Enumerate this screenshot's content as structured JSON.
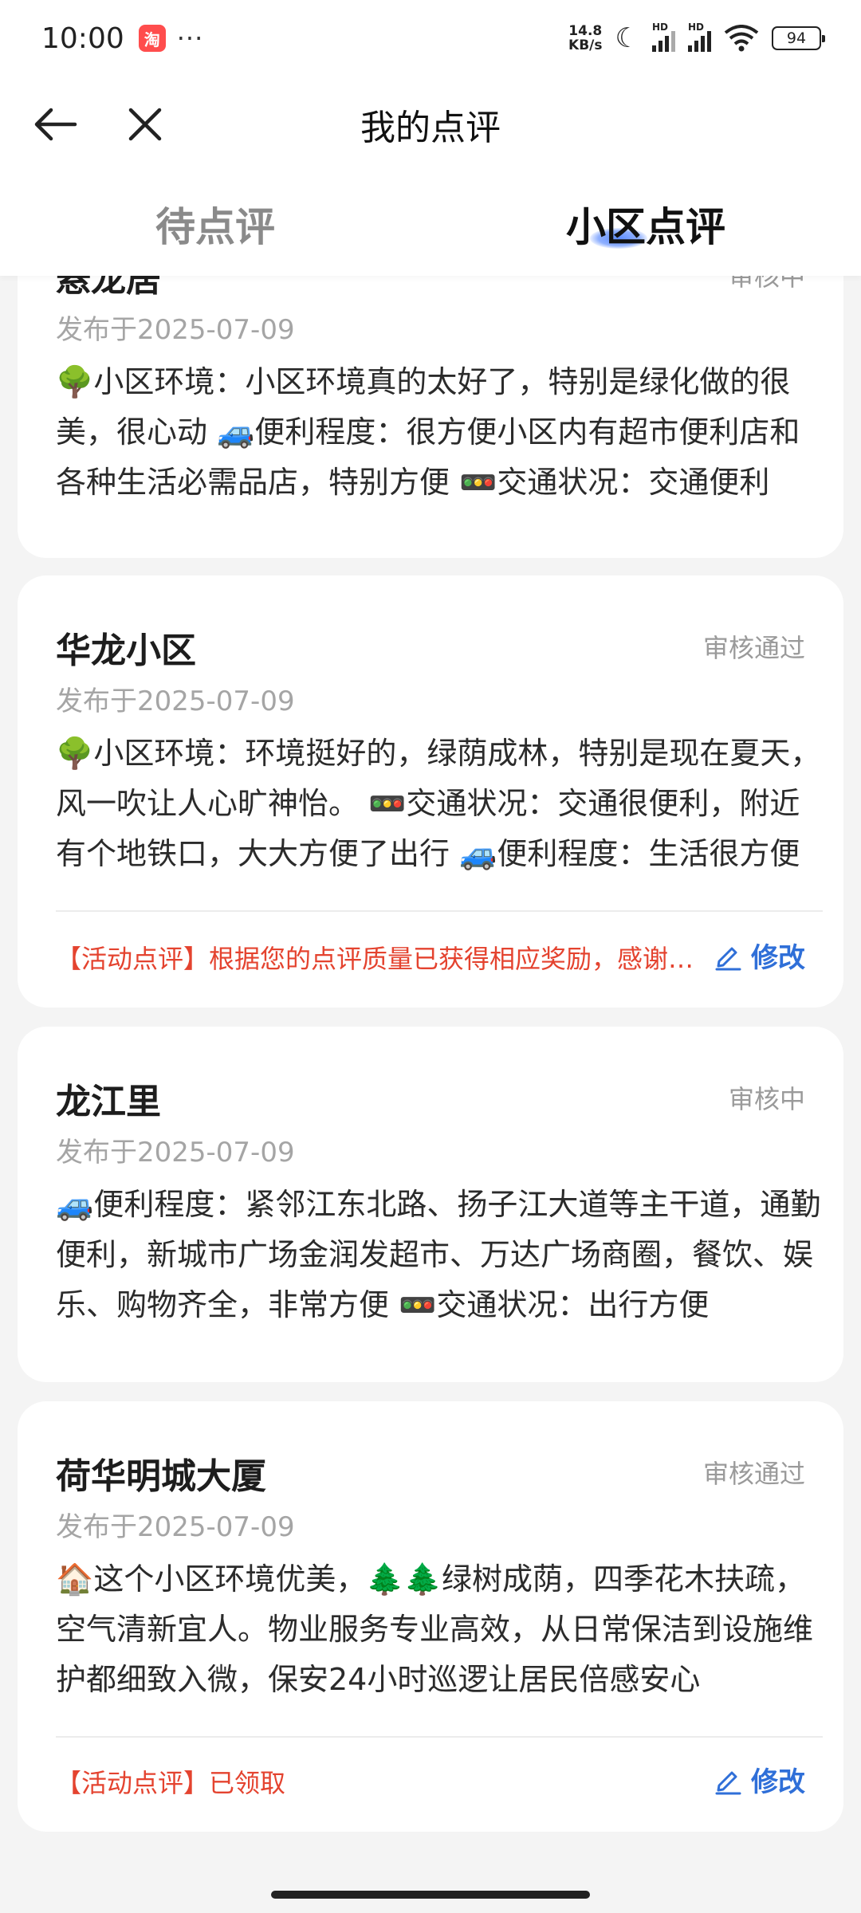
{
  "status_bar": {
    "time": "10:00",
    "app_icon": "taobao-icon",
    "dots": "···",
    "speed_value": "14.8",
    "speed_unit": "KB/s",
    "hd_label": "HD",
    "battery": "94"
  },
  "nav": {
    "title": "我的点评"
  },
  "tabs": [
    {
      "label": "待点评",
      "active": false
    },
    {
      "label": "小区点评",
      "active": true
    }
  ],
  "reviews": [
    {
      "name": "悬龙居",
      "status": "审核中",
      "date": "发布于2025-07-09",
      "text": "🌳小区环境：小区环境真的太好了，特别是绿化做的很美，很心动 🚙便利程度：很方便小区内有超市便利店和各种生活必需品店，特别方便 🚥交通状况：交通便利",
      "reward": null,
      "edit": null
    },
    {
      "name": "华龙小区",
      "status": "审核通过",
      "date": "发布于2025-07-09",
      "text": "🌳小区环境：环境挺好的，绿荫成林，特别是现在夏天，风一吹让人心旷神怡。 🚥交通状况：交通很便利，附近有个地铁口，大大方便了出行 🚙便利程度：生活很方便",
      "reward": "【活动点评】根据您的点评质量已获得相应奖励，感谢参与",
      "edit": "修改"
    },
    {
      "name": "龙江里",
      "status": "审核中",
      "date": "发布于2025-07-09",
      "text": "🚙便利程度：紧邻江东北路、扬子江大道等主干道，通勤便利，新城市广场金润发超市、万达广场商圈，餐饮、娱乐、购物齐全，非常方便 🚥交通状况：出行方便",
      "reward": null,
      "edit": null
    },
    {
      "name": "荷华明城大厦",
      "status": "审核通过",
      "date": "发布于2025-07-09",
      "text": "🏠这个小区环境优美，🌲🌲绿树成荫，四季花木扶疏，空气清新宜人。物业服务专业高效，从日常保洁到设施维护都细致入微，保安24小时巡逻让居民倍感安心",
      "reward": "【活动点评】已领取",
      "edit": "修改"
    }
  ]
}
